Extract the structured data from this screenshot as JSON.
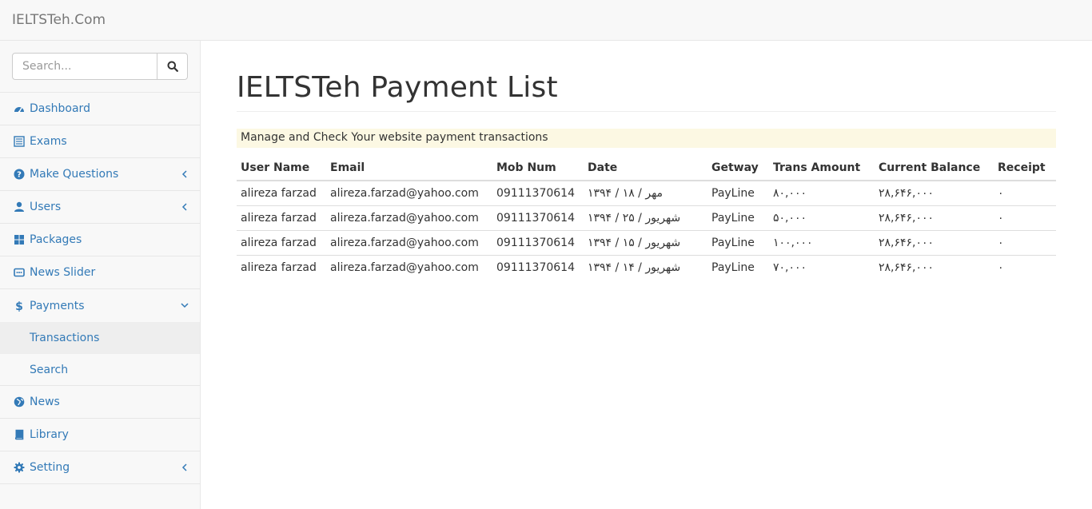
{
  "brand": "IELTSTeh.Com",
  "search": {
    "placeholder": "Search..."
  },
  "sidebar": {
    "items": [
      {
        "label": "Dashboard",
        "icon": "dashboard-icon"
      },
      {
        "label": "Exams",
        "icon": "list-icon"
      },
      {
        "label": "Make Questions",
        "icon": "question-icon",
        "chevron": "left"
      },
      {
        "label": "Users",
        "icon": "user-icon",
        "chevron": "left"
      },
      {
        "label": "Packages",
        "icon": "grid-icon"
      },
      {
        "label": "News Slider",
        "icon": "slider-icon"
      },
      {
        "label": "Payments",
        "icon": "dollar-icon",
        "chevron": "down",
        "children": [
          {
            "label": "Transactions",
            "active": true
          },
          {
            "label": "Search"
          }
        ]
      },
      {
        "label": "News",
        "icon": "globe-icon"
      },
      {
        "label": "Library",
        "icon": "book-icon"
      },
      {
        "label": "Setting",
        "icon": "gear-icon",
        "chevron": "left"
      }
    ]
  },
  "main": {
    "title": "IELTSTeh Payment List",
    "notice": "Manage and Check Your website payment transactions",
    "table": {
      "headers": [
        "User Name",
        "Email",
        "Mob Num",
        "Date",
        "Getway",
        "Trans Amount",
        "Current Balance",
        "Receipt"
      ],
      "rows": [
        [
          "alireza farzad",
          "alireza.farzad@yahoo.com",
          "09111370614",
          "۱۳۹۴ / ۱۸ / مهر",
          "PayLine",
          "۸۰,۰۰۰",
          "۲۸,۶۴۶,۰۰۰",
          "۰"
        ],
        [
          "alireza farzad",
          "alireza.farzad@yahoo.com",
          "09111370614",
          "۱۳۹۴ / ۲۵ / شهریور",
          "PayLine",
          "۵۰,۰۰۰",
          "۲۸,۶۴۶,۰۰۰",
          "۰"
        ],
        [
          "alireza farzad",
          "alireza.farzad@yahoo.com",
          "09111370614",
          "۱۳۹۴ / ۱۵ / شهریور",
          "PayLine",
          "۱۰۰,۰۰۰",
          "۲۸,۶۴۶,۰۰۰",
          "۰"
        ],
        [
          "alireza farzad",
          "alireza.farzad@yahoo.com",
          "09111370614",
          "۱۳۹۴ / ۱۴ / شهریور",
          "PayLine",
          "۷۰,۰۰۰",
          "۲۸,۶۴۶,۰۰۰",
          "۰"
        ]
      ]
    }
  },
  "colors": {
    "link": "#337ab7",
    "notice_bg": "#fcf8e3",
    "sidebar_bg": "#f8f8f8",
    "active_bg": "#eeeeee"
  }
}
